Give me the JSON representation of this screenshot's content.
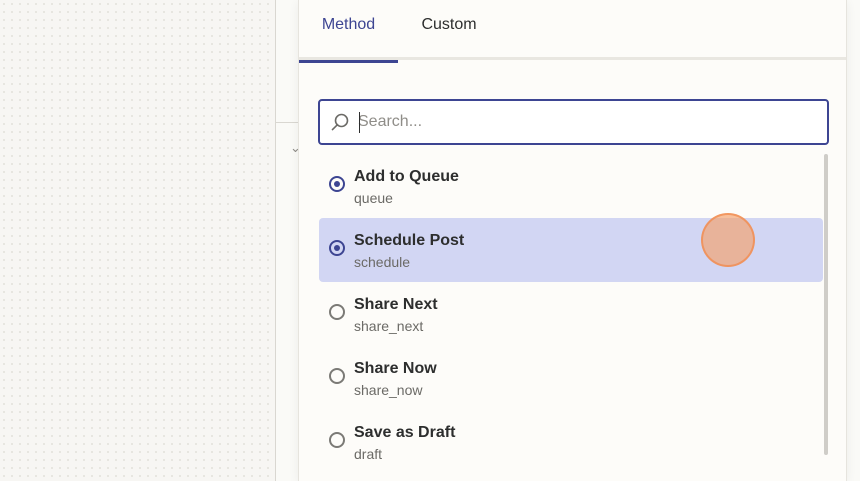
{
  "tabs": [
    {
      "label": "Method",
      "active": true
    },
    {
      "label": "Custom",
      "active": false
    }
  ],
  "search": {
    "value": "",
    "placeholder": "Search..."
  },
  "options": [
    {
      "label": "Add to Queue",
      "value": "queue",
      "selected": true,
      "highlighted": false
    },
    {
      "label": "Schedule Post",
      "value": "schedule",
      "selected": true,
      "highlighted": true
    },
    {
      "label": "Share Next",
      "value": "share_next",
      "selected": false,
      "highlighted": false
    },
    {
      "label": "Share Now",
      "value": "share_now",
      "selected": false,
      "highlighted": false
    },
    {
      "label": "Save as Draft",
      "value": "draft",
      "selected": false,
      "highlighted": false
    }
  ],
  "colors": {
    "accent": "#3d4592",
    "highlight": "#d2d6f3",
    "cursor": "#f4a06a"
  },
  "icons": {
    "search": "search-icon",
    "side_chevron": "chevron-down-icon"
  }
}
